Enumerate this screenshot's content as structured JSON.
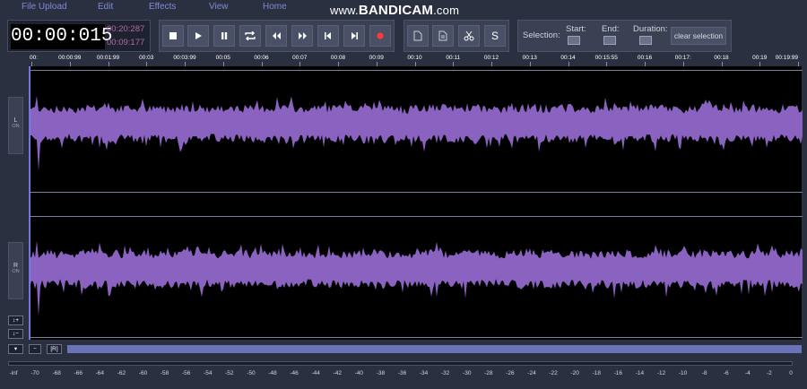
{
  "menu": [
    "File Upload",
    "Edit",
    "Effects",
    "View",
    "Home"
  ],
  "watermark": {
    "prefix": "www.",
    "brand": "BANDICAM",
    "suffix": ".com"
  },
  "time": {
    "current": "00:00:015",
    "total": "00:20:287",
    "selection": "00:09:177"
  },
  "transport": [
    "stop-icon",
    "play-icon",
    "pause-icon",
    "loop-icon",
    "rewind-icon",
    "fast-forward-icon",
    "skip-start-icon",
    "skip-end-icon",
    "record-icon"
  ],
  "edit_tools": [
    "copy-icon",
    "paste-icon",
    "cut-icon"
  ],
  "edit_tool_s_label": "S",
  "selection": {
    "label": "Selection:",
    "start_label": "Start:",
    "end_label": "End:",
    "duration_label": "Duration:",
    "clear_label": "clear selection"
  },
  "ruler_ticks": [
    "00:",
    "00:00:99",
    "00:01:99",
    "00:03",
    "00:03:99",
    "00:05",
    "00:06",
    "00:07",
    "00:08",
    "00:09",
    "00:10",
    "00:11",
    "00:12",
    "00:13",
    "00:14",
    "00:15:55",
    "00:16",
    "00:17:",
    "00:18",
    "00:19",
    "00:19:99"
  ],
  "channels": [
    {
      "name": "L",
      "state": "ON"
    },
    {
      "name": "R",
      "state": "ON"
    }
  ],
  "zoom": {
    "in_label": "↕+",
    "out_label": "↕−"
  },
  "bottom": {
    "toggle_label": "▾",
    "minus_label": "−",
    "reset_label": "[R]"
  },
  "meter_labels": [
    "-inf",
    "-70",
    "-68",
    "-66",
    "-64",
    "-62",
    "-60",
    "-58",
    "-56",
    "-54",
    "-52",
    "-50",
    "-48",
    "-46",
    "-44",
    "-42",
    "-40",
    "-38",
    "-36",
    "-34",
    "-32",
    "-30",
    "-28",
    "-26",
    "-24",
    "-22",
    "-20",
    "-18",
    "-16",
    "-14",
    "-12",
    "-10",
    "-8",
    "-6",
    "-4",
    "-2",
    "0"
  ],
  "colors": {
    "background": "#2b3040",
    "waveform": "#8a62c0",
    "menu": "#7e8ad6",
    "time_sub": "#b06aa6",
    "scrollbar": "#6a72b8",
    "record": "#ff3b3b"
  }
}
